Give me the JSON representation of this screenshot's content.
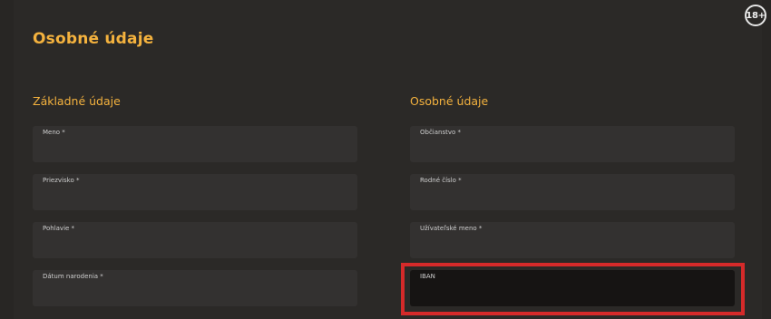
{
  "age_badge": "18+",
  "page_title": "Osobné údaje",
  "sections": {
    "left_title": "Základné údaje",
    "right_title": "Osobné údaje"
  },
  "fields": {
    "first_name": {
      "label": "Meno *",
      "value": ""
    },
    "last_name": {
      "label": "Priezvisko *",
      "value": ""
    },
    "gender": {
      "label": "Pohlavie *",
      "value": ""
    },
    "birth_date": {
      "label": "Dátum narodenia *",
      "value": ""
    },
    "citizenship": {
      "label": "Občianstvo *",
      "value": ""
    },
    "birth_number": {
      "label": "Rodné číslo *",
      "value": ""
    },
    "username": {
      "label": "Užívateľské meno *",
      "value": ""
    },
    "iban": {
      "label": "IBAN",
      "value": ""
    }
  },
  "colors": {
    "accent": "#f4b23e",
    "highlight": "#d52a2a",
    "field_bg": "#333130",
    "page_bg": "#2b2927"
  }
}
